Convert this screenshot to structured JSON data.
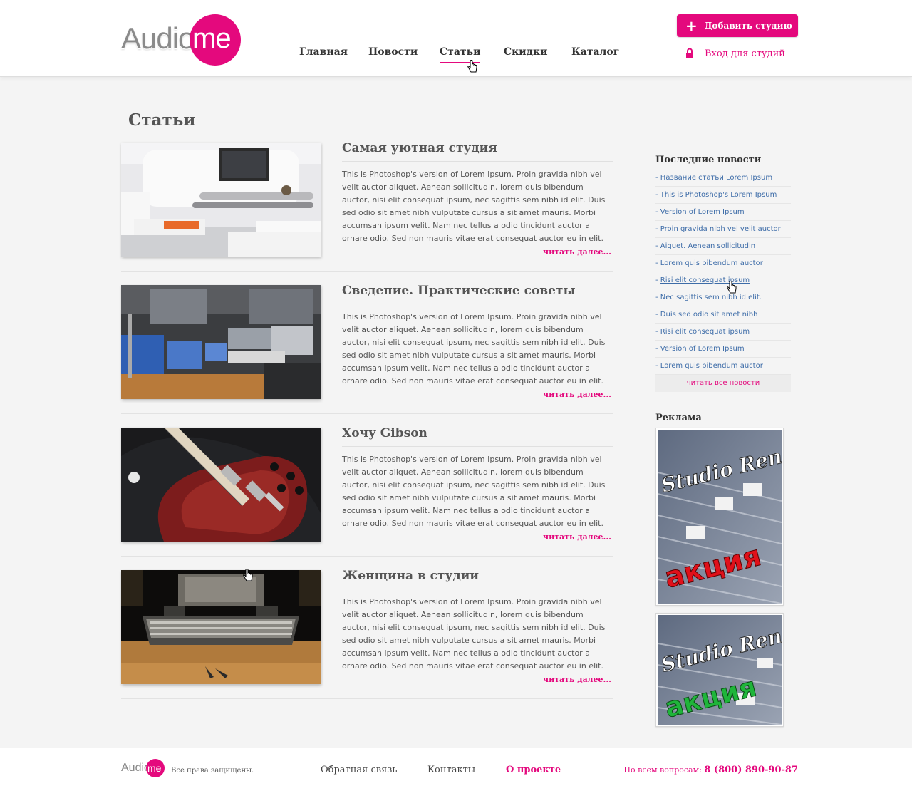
{
  "logo": {
    "audio": "Audio",
    "me": "me"
  },
  "nav": {
    "items": [
      {
        "label": "Главная"
      },
      {
        "label": "Новости"
      },
      {
        "label": "Статьи",
        "active": true
      },
      {
        "label": "Скидки"
      },
      {
        "label": "Каталог"
      }
    ]
  },
  "header": {
    "add_studio_label": "Добавить студию",
    "login_label": "Вход для студий"
  },
  "page": {
    "title": "Статьи"
  },
  "articles": [
    {
      "title": "Самая уютная студия",
      "text": "This is Photoshop's version  of Lorem Ipsum. Proin gravida nibh vel velit auctor aliquet. Aenean sollicitudin, lorem quis bibendum auctor, nisi elit consequat ipsum, nec sagittis sem nibh id elit. Duis sed odio sit amet nibh vulputate cursus a sit amet mauris. Morbi accumsan ipsum velit. Nam nec tellus a odio tincidunt auctor a ornare odio. Sed non mauris vitae erat consequat auctor eu in elit.",
      "read_more": "читать далее..."
    },
    {
      "title": "Сведение. Практические советы",
      "text": "This is Photoshop's version  of Lorem Ipsum. Proin gravida nibh vel velit auctor aliquet. Aenean sollicitudin, lorem quis bibendum auctor, nisi elit consequat ipsum, nec sagittis sem nibh id elit. Duis sed odio sit amet nibh vulputate cursus a sit amet mauris. Morbi accumsan ipsum velit. Nam nec tellus a odio tincidunt auctor a ornare odio. Sed non mauris vitae erat consequat auctor eu in elit.",
      "read_more": "читать далее..."
    },
    {
      "title": "Хочу Gibson",
      "text": "This is Photoshop's version  of Lorem Ipsum. Proin gravida nibh vel velit auctor aliquet. Aenean sollicitudin, lorem quis bibendum auctor, nisi elit consequat ipsum, nec sagittis sem nibh id elit. Duis sed odio sit amet nibh vulputate cursus a sit amet mauris. Morbi accumsan ipsum velit. Nam nec tellus a odio tincidunt auctor a ornare odio. Sed non mauris vitae erat consequat auctor eu in elit.",
      "read_more": "читать далее..."
    },
    {
      "title": "Женщина в студии",
      "text": "This is Photoshop's version  of Lorem Ipsum. Proin gravida nibh vel velit auctor aliquet. Aenean sollicitudin, lorem quis bibendum auctor, nisi elit consequat ipsum, nec sagittis sem nibh id elit. Duis sed odio sit amet nibh vulputate cursus a sit amet mauris. Morbi accumsan ipsum velit. Nam nec tellus a odio tincidunt auctor a ornare odio. Sed non mauris vitae erat consequat auctor eu in elit.",
      "read_more": "читать далее..."
    }
  ],
  "sidebar": {
    "news_title": "Последние новости",
    "news": [
      "Название статьи Lorem Ipsum",
      "This is Photoshop's Lorem Ipsum",
      "Version of Lorem Ipsum",
      "Proin gravida nibh vel velit auctor",
      "Aiquet. Aenean sollicitudin",
      "Lorem quis bibendum auctor",
      "Risi elit consequat ipsum",
      "Nec sagittis sem nibh id elit.",
      "Duis sed odio sit amet nibh",
      "Risi elit consequat ipsum",
      "Version of Lorem Ipsum",
      "Lorem quis bibendum auctor"
    ],
    "news_prefix": "- ",
    "all_news_label": "читать все новости",
    "ads_title": "Реклама",
    "ads": [
      {
        "line1": "Studio Rent",
        "line2": "акция",
        "accent": "#e0101a"
      },
      {
        "line1": "Studio Rent",
        "line2": "акция",
        "accent": "#1fb53a"
      }
    ]
  },
  "footer": {
    "logo_audio": "Audio",
    "logo_me": "me",
    "copyright": "Все права защищены.",
    "links": [
      "Обратная связь",
      "Контакты",
      "О проекте"
    ],
    "phone_label": "По всем вопросам:",
    "phone": "8 (800) 890-90-87"
  },
  "colors": {
    "accent": "#e4097d",
    "link": "#3d6ca8",
    "text": "#555555"
  },
  "icons": [
    "plus-icon",
    "lock-icon",
    "hand-cursor-icon"
  ]
}
